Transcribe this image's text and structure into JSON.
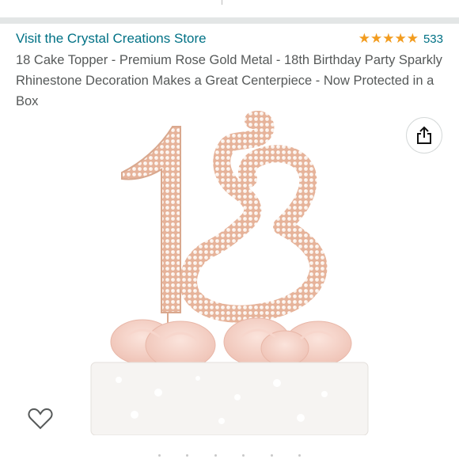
{
  "store": {
    "link_label": "Visit the Crystal Creations Store"
  },
  "rating": {
    "stars": 5,
    "count": "533",
    "star_color": "#f29c1f"
  },
  "product": {
    "title": "18 Cake Topper - Premium Rose Gold Metal - 18th Birthday Party Sparkly Rhinestone Decoration Makes a Great Centerpiece - Now Protected in a Box"
  },
  "icons": {
    "share": "share-icon",
    "wishlist": "heart-icon"
  },
  "colors": {
    "link": "#007185",
    "title": "#565959",
    "rose_gold": "#e8b9a0"
  }
}
